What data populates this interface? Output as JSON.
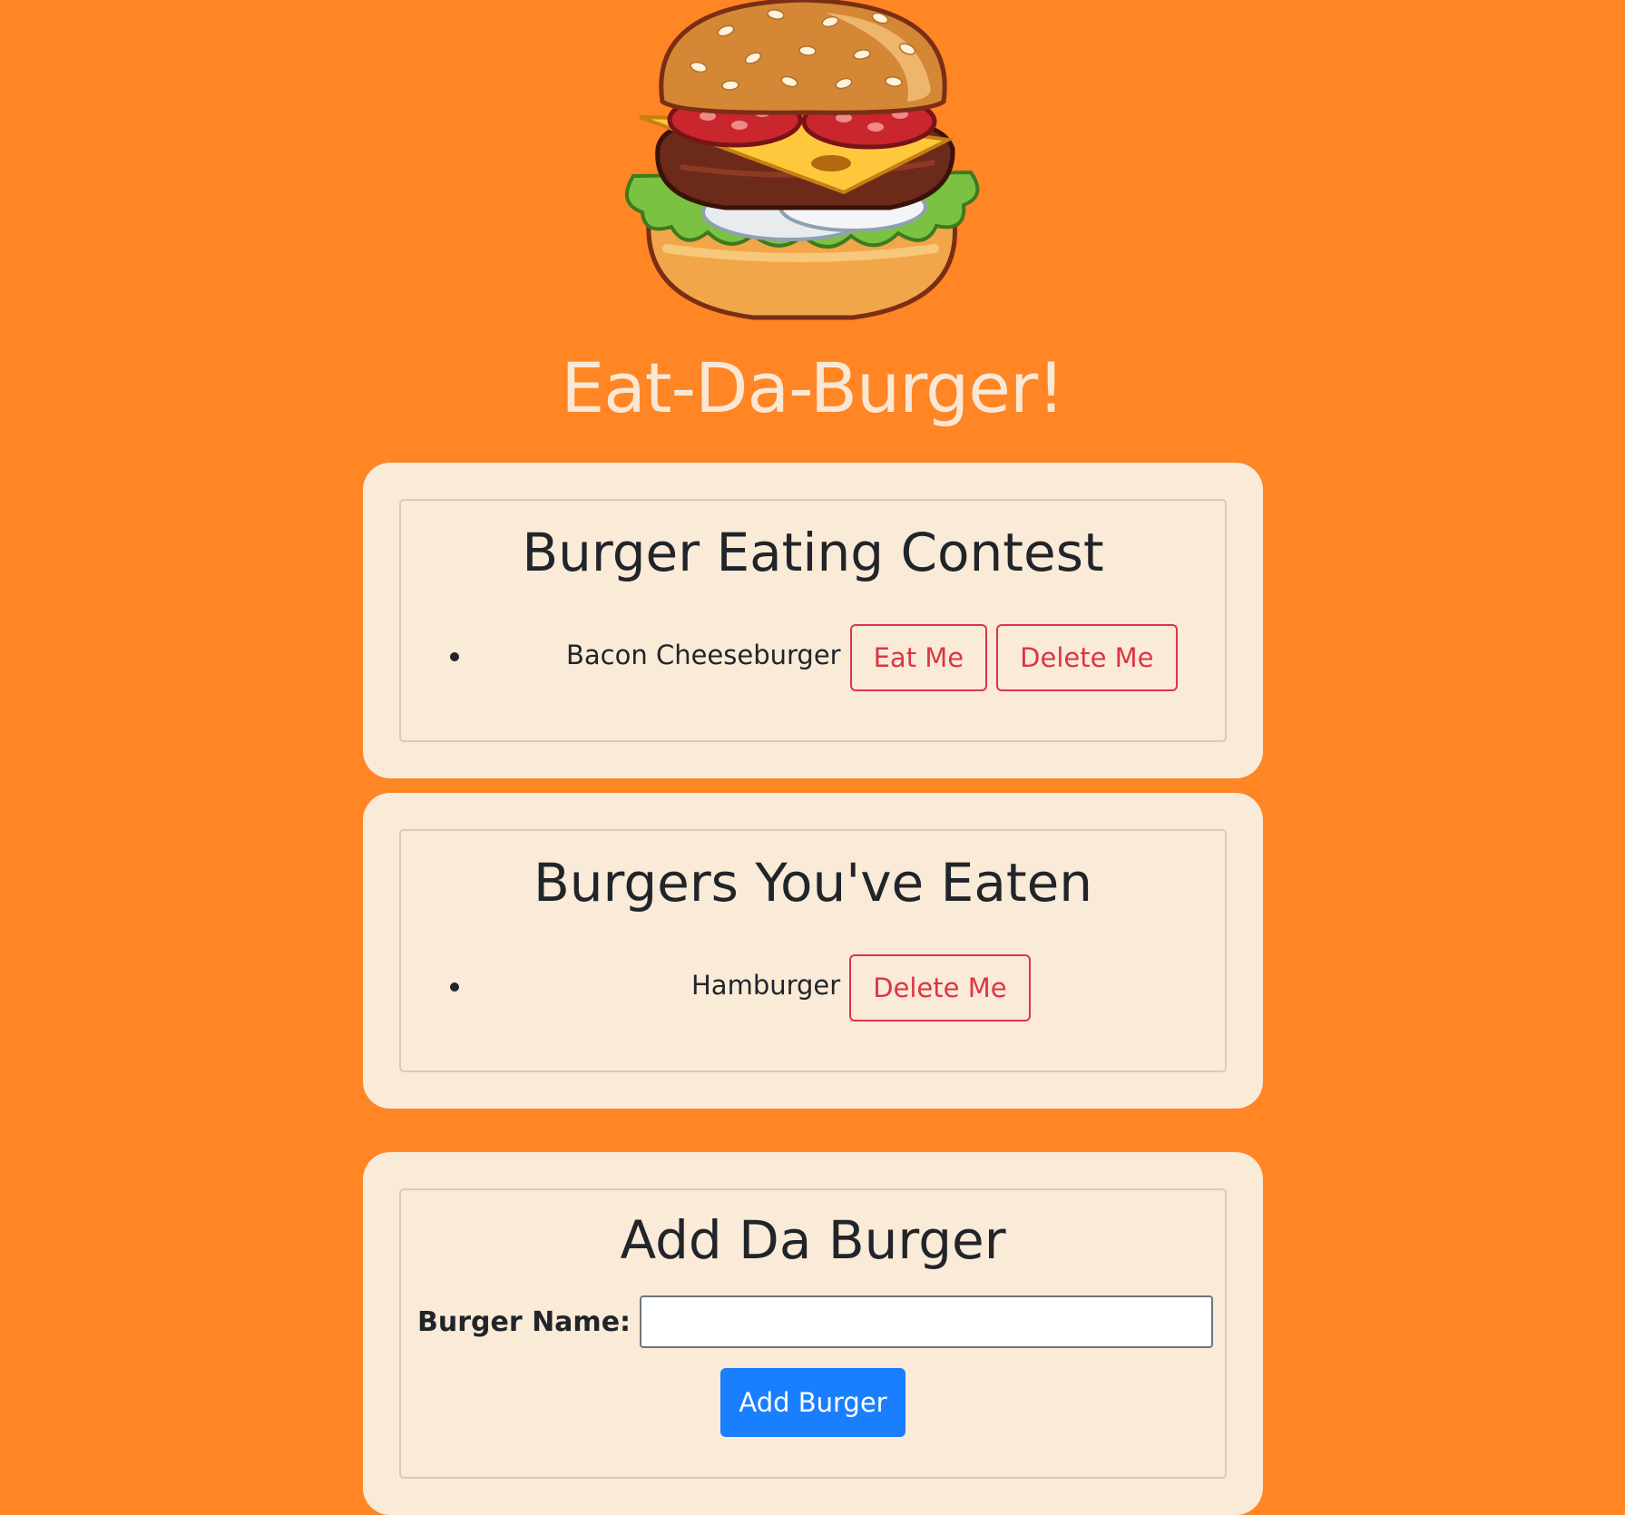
{
  "logo": {
    "icon": "burger-icon"
  },
  "header": {
    "title": "Eat-Da-Burger!"
  },
  "contest": {
    "heading": "Burger Eating Contest",
    "items": [
      {
        "name": "Bacon Cheeseburger",
        "eat_label": "Eat Me",
        "delete_label": "Delete Me"
      }
    ]
  },
  "eaten": {
    "heading": "Burgers You've Eaten",
    "items": [
      {
        "name": "Hamburger",
        "delete_label": "Delete Me"
      }
    ]
  },
  "add": {
    "heading": "Add Da Burger",
    "label": "Burger Name:",
    "input_value": "",
    "button_label": "Add Burger"
  },
  "colors": {
    "background": "#FF8525",
    "card": "#FAEAD8",
    "danger": "#DC3545",
    "primary": "#1A7FFF",
    "title": "#F9E8D5"
  }
}
